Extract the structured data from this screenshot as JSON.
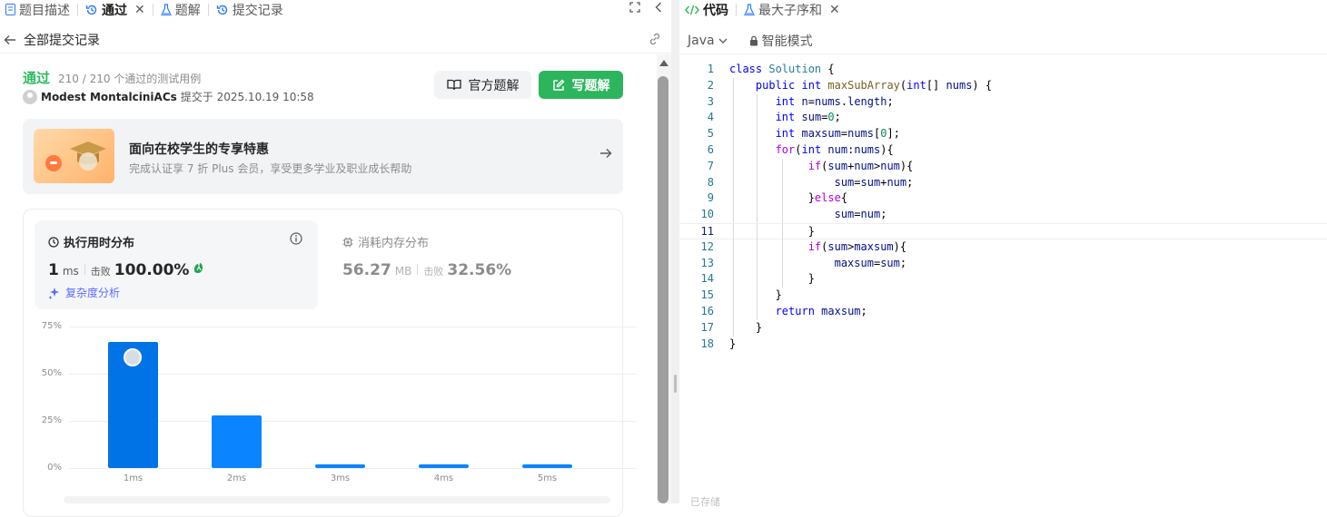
{
  "left_tabs": [
    {
      "label": "题目描述",
      "icon": "document-icon"
    },
    {
      "label": "通过",
      "icon": "history-icon",
      "active": true
    },
    {
      "label": "题解",
      "icon": "flask-icon"
    },
    {
      "label": "提交记录",
      "icon": "history-icon"
    }
  ],
  "close_glyph": "✕",
  "subheader": {
    "back_label": "全部提交记录"
  },
  "submission": {
    "status": "通过",
    "passed_text": "210 / 210 个通过的测试用例",
    "author": "Modest MontalciniACs",
    "submitted_text": "提交于 2025.10.19 10:58"
  },
  "buttons": {
    "official": "官方题解",
    "write": "写题解"
  },
  "promo": {
    "title": "面向在校学生的专享特惠",
    "subtitle": "完成认证享 7 折 Plus 会员，享受更多学业及职业成长帮助"
  },
  "runtime": {
    "title": "执行用时分布",
    "value": "1",
    "unit": "ms",
    "beat_label": "击败",
    "beat_value": "100.00%",
    "complexity_label": "复杂度分析"
  },
  "memory": {
    "title": "消耗内存分布",
    "value": "56.27",
    "unit": "MB",
    "beat_label": "击败",
    "beat_value": "32.56%"
  },
  "colors": {
    "accent_green": "#2cbb5d",
    "bar_primary": "#0073e6",
    "bar_secondary": "#0a84ff"
  },
  "chart_data": {
    "type": "bar",
    "categories": [
      "1ms",
      "2ms",
      "3ms",
      "4ms",
      "5ms"
    ],
    "values": [
      67,
      28,
      2,
      2,
      2
    ],
    "ylim": [
      0,
      75
    ],
    "yticks": [
      "75%",
      "50%",
      "25%",
      "0%"
    ],
    "ytick_values": [
      75,
      50,
      25,
      0
    ],
    "highlight_index": 0,
    "grid": true
  },
  "right_tabs": [
    {
      "label": "代码",
      "icon": "code-icon",
      "active": true
    },
    {
      "label": "最大子序和",
      "icon": "flask-icon"
    }
  ],
  "editor": {
    "language": "Java",
    "mode": "智能模式",
    "status_text": "已存储"
  },
  "code_lines": [
    "class Solution {",
    "    public int maxSubArray(int[] nums) {",
    "       int n=nums.length;",
    "       int sum=0;",
    "       int maxsum=nums[0];",
    "       for(int num:nums){",
    "            if(sum+num>num){",
    "                sum=sum+num;",
    "            }else{",
    "                sum=num;",
    "            }",
    "            if(sum>maxsum){",
    "                maxsum=sum;",
    "            }",
    "       }",
    "       return maxsum;",
    "    }",
    "}"
  ]
}
